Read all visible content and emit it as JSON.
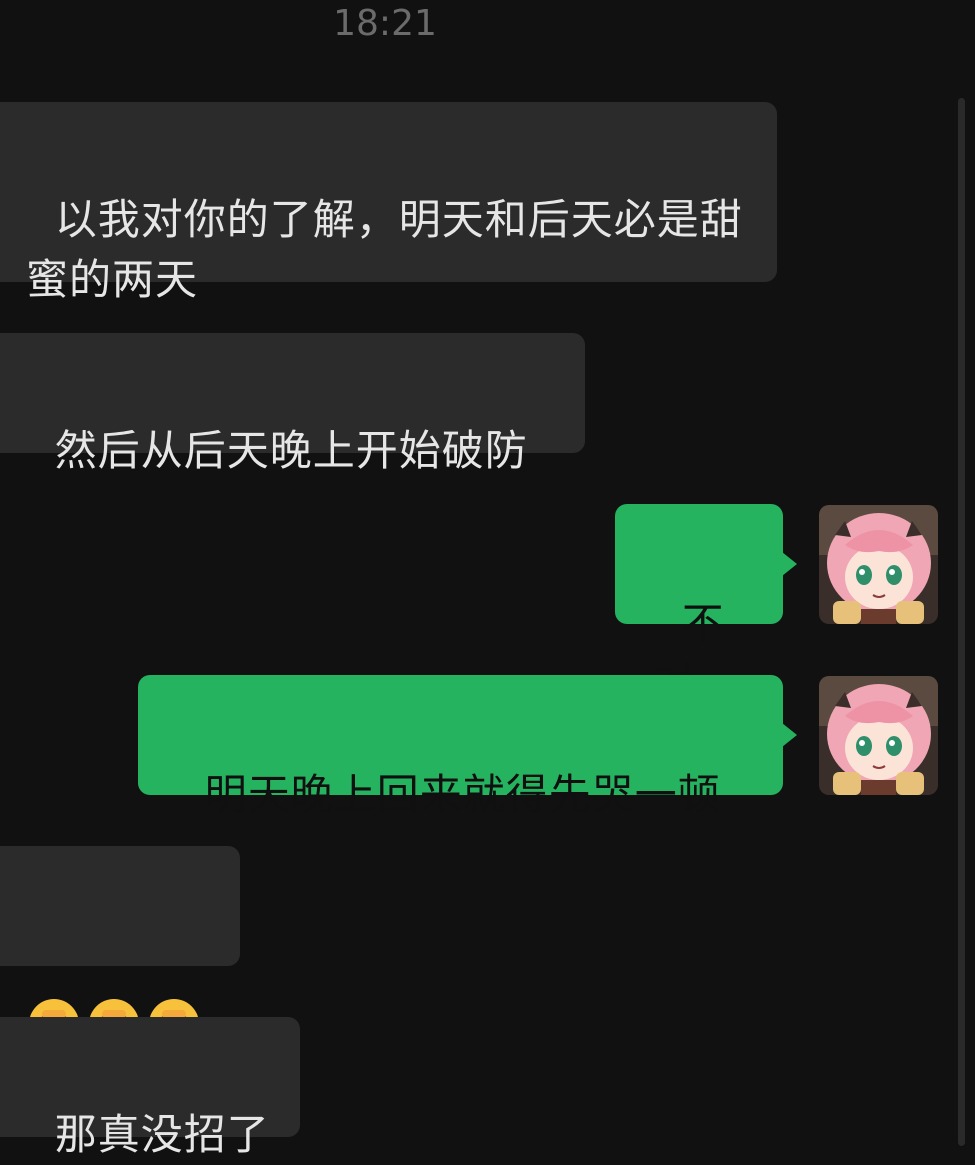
{
  "chat": {
    "timestamp": "18:21",
    "messages": [
      {
        "side": "incoming",
        "text": "以我对你的了解，明天和后天必是甜蜜的两天"
      },
      {
        "side": "incoming",
        "text": "然后从后天晚上开始破防"
      },
      {
        "side": "outgoing",
        "text": "不对"
      },
      {
        "side": "outgoing",
        "text": "明天晚上回来就得先哭一顿"
      },
      {
        "side": "incoming",
        "emoji": [
          "face-palm-crying-emoji",
          "face-palm-crying-emoji",
          "face-palm-crying-emoji"
        ]
      },
      {
        "side": "incoming",
        "text": "那真没招了"
      }
    ]
  },
  "colors": {
    "background": "#111111",
    "incoming_bubble": "#2b2b2b",
    "outgoing_bubble": "#26b35f",
    "timestamp": "#6b6b6b"
  },
  "avatar": {
    "icon": "anime-girl-avatar"
  }
}
